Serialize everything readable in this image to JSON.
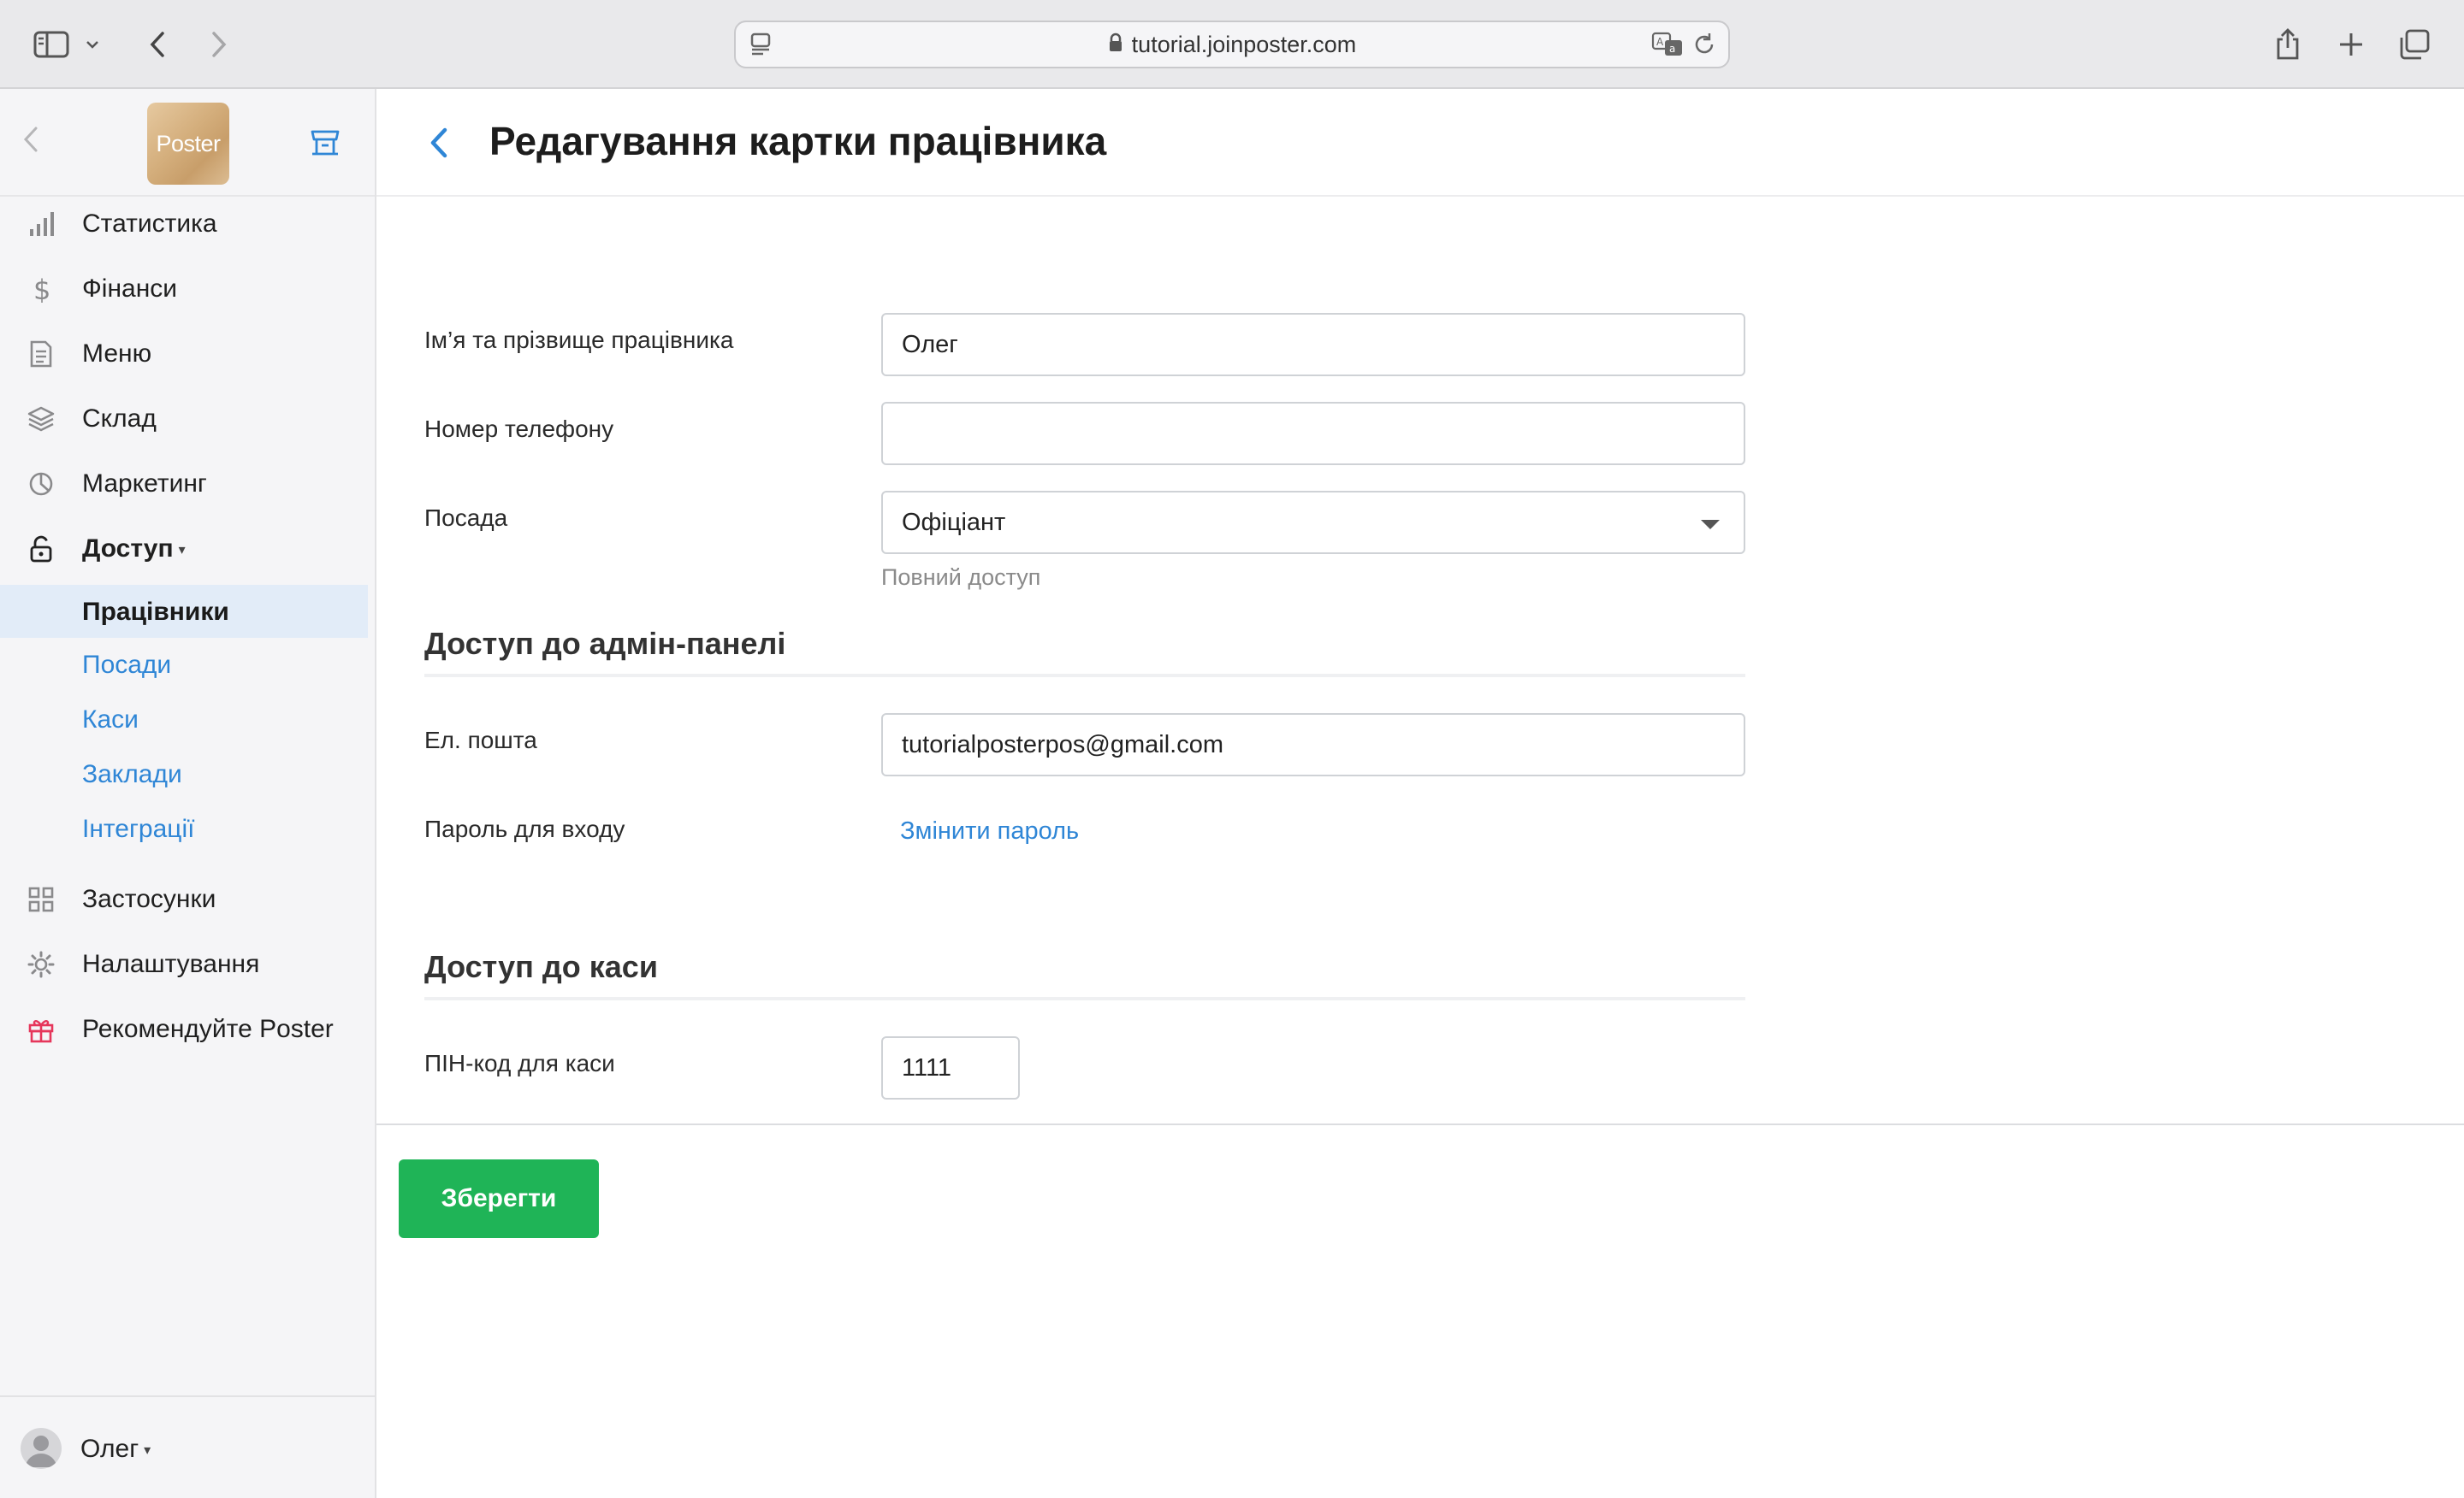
{
  "browser": {
    "url": "tutorial.joinposter.com"
  },
  "sidebar": {
    "logo_text": "Poster",
    "items": [
      {
        "label": "Статистика",
        "icon": "bar-chart-icon"
      },
      {
        "label": "Фінанси",
        "icon": "dollar-icon"
      },
      {
        "label": "Меню",
        "icon": "document-icon"
      },
      {
        "label": "Склад",
        "icon": "layers-icon"
      },
      {
        "label": "Маркетинг",
        "icon": "pie-chart-icon"
      },
      {
        "label": "Доступ",
        "icon": "lock-open-icon"
      }
    ],
    "sub_items": [
      {
        "label": "Працівники",
        "active": true
      },
      {
        "label": "Посади",
        "active": false
      },
      {
        "label": "Каси",
        "active": false
      },
      {
        "label": "Заклади",
        "active": false
      },
      {
        "label": "Інтеграції",
        "active": false
      }
    ],
    "bottom_items": [
      {
        "label": "Застосунки",
        "icon": "grid-icon"
      },
      {
        "label": "Налаштування",
        "icon": "gear-icon"
      },
      {
        "label": "Рекомендуйте Poster",
        "icon": "gift-icon"
      }
    ],
    "user": {
      "name": "Олег"
    }
  },
  "page": {
    "title": "Редагування картки працівника"
  },
  "form": {
    "name_label": "Ім’я та прізвище працівника",
    "name_value": "Олег",
    "phone_label": "Номер телефону",
    "phone_value": "",
    "position_label": "Посада",
    "position_value": "Офіціант",
    "position_hint": "Повний доступ",
    "admin_section_title": "Доступ до адмін-панелі",
    "email_label": "Ел. пошта",
    "email_value": "tutorialposterpos@gmail.com",
    "password_label": "Пароль для входу",
    "password_link": "Змінити пароль",
    "pos_section_title": "Доступ до каси",
    "pin_label": "ПІН-код для каси",
    "pin_value": "1111"
  },
  "actions": {
    "save_label": "Зберегти"
  },
  "colors": {
    "accent_blue": "#2f86d6",
    "save_green": "#1fb457",
    "gift_red": "#e6365b"
  }
}
